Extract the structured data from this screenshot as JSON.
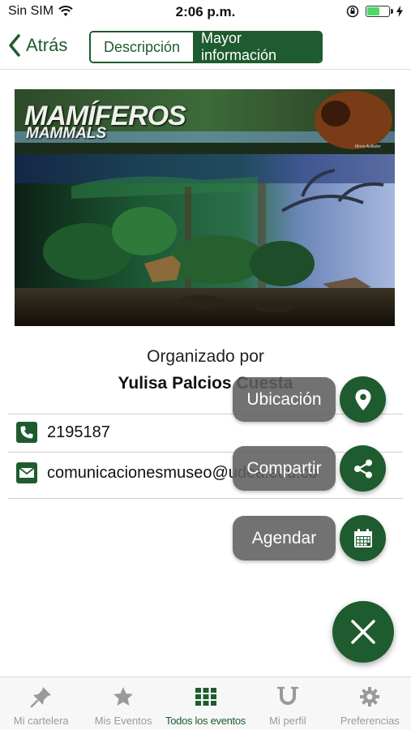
{
  "status_bar": {
    "carrier": "Sin SIM",
    "time": "2:06 p.m.",
    "battery_level": 0.55
  },
  "nav": {
    "back_label": "Atrás",
    "tabs": [
      {
        "label": "Descripción",
        "active": false
      },
      {
        "label": "Mayor información",
        "active": true
      }
    ]
  },
  "hero_image": {
    "title_es": "MAMÍFEROS",
    "title_en": "MAMMALS",
    "credit": "Mono Aullador"
  },
  "organizer": {
    "label": "Organizado por",
    "name": "Yulisa Palcios Cuesta"
  },
  "contact": {
    "phone": "2195187",
    "email": "comunicacionesmuseo@udea.edu.co"
  },
  "fab_menu": {
    "items": [
      {
        "label": "Ubicación",
        "icon": "location-pin-icon"
      },
      {
        "label": "Compartir",
        "icon": "share-icon"
      },
      {
        "label": "Agendar",
        "icon": "calendar-icon"
      }
    ],
    "close_icon": "close-icon"
  },
  "tab_bar": {
    "items": [
      {
        "label": "Mi cartelera",
        "icon": "pin-icon",
        "active": false
      },
      {
        "label": "Mis Eventos",
        "icon": "star-icon",
        "active": false
      },
      {
        "label": "Todos los eventos",
        "icon": "grid-icon",
        "active": true
      },
      {
        "label": "Mi perfil",
        "icon": "horseshoe-icon",
        "active": false
      },
      {
        "label": "Preferencias",
        "icon": "gear-icon",
        "active": false
      }
    ]
  },
  "colors": {
    "primary": "#1e5b2e",
    "fab_label_bg": "#5f5f5f",
    "inactive_tab": "#9a9a9a"
  }
}
